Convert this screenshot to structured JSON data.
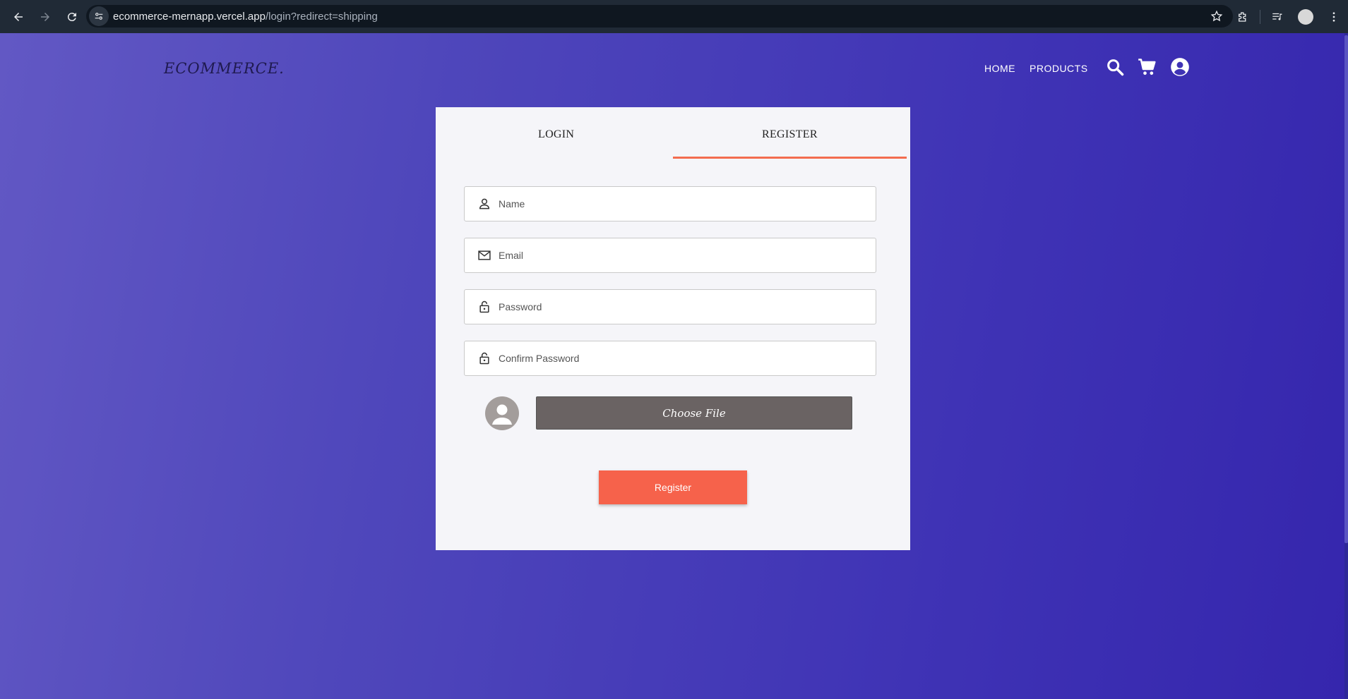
{
  "browser": {
    "url_host": "ecommerce-mernapp.vercel.app",
    "url_path": "/login?redirect=shipping"
  },
  "site": {
    "logo": "ECOMMERCE.",
    "nav": {
      "home": "HOME",
      "products": "PRODUCTS"
    },
    "icons": [
      "search-icon",
      "cart-icon",
      "user-account-icon"
    ]
  },
  "auth_card": {
    "tabs": {
      "login": "LOGIN",
      "register": "REGISTER"
    },
    "active_tab": "REGISTER",
    "fields": {
      "name": {
        "placeholder": "Name",
        "value": ""
      },
      "email": {
        "placeholder": "Email",
        "value": ""
      },
      "password": {
        "placeholder": "Password",
        "value": ""
      },
      "confirm_password": {
        "placeholder": "Confirm Password",
        "value": ""
      }
    },
    "choose_file_label": "Choose File",
    "register_label": "Register"
  },
  "colors": {
    "accent": "#f6624b",
    "tab_underline": "#f36c4f",
    "choose_file_bg": "#6a6363",
    "gradient_start": "#6258c4",
    "gradient_end": "#3526ad"
  }
}
